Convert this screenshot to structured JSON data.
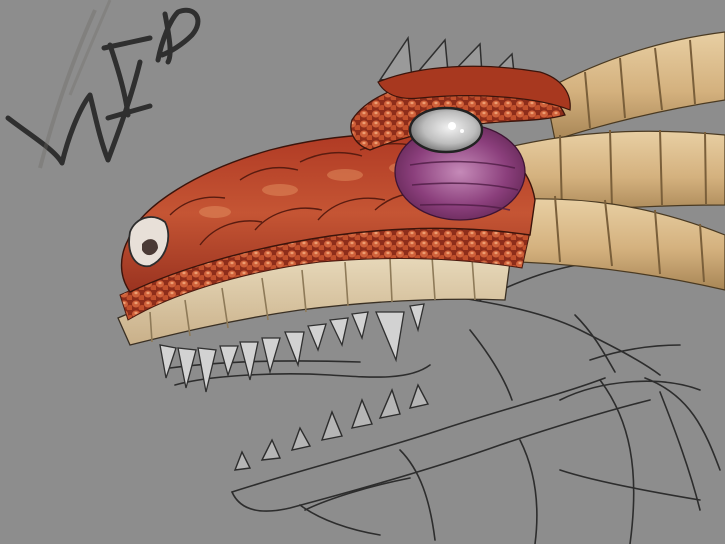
{
  "artwork": {
    "handwritten_text": "WIP",
    "colors": {
      "background": "#8d8d8d",
      "scales_dark_red": "#8f2b1c",
      "scales_red": "#b84a2e",
      "scales_orange": "#cf6a3e",
      "beads": "#c9552f",
      "horn_tan": "#d9b98a",
      "horn_shadow": "#a88656",
      "jaw_cream": "#e1cfaa",
      "eye_purple": "#7a3a6f",
      "eye_white": "#d8d8d8",
      "sketch_line": "#2b2b2b"
    }
  }
}
